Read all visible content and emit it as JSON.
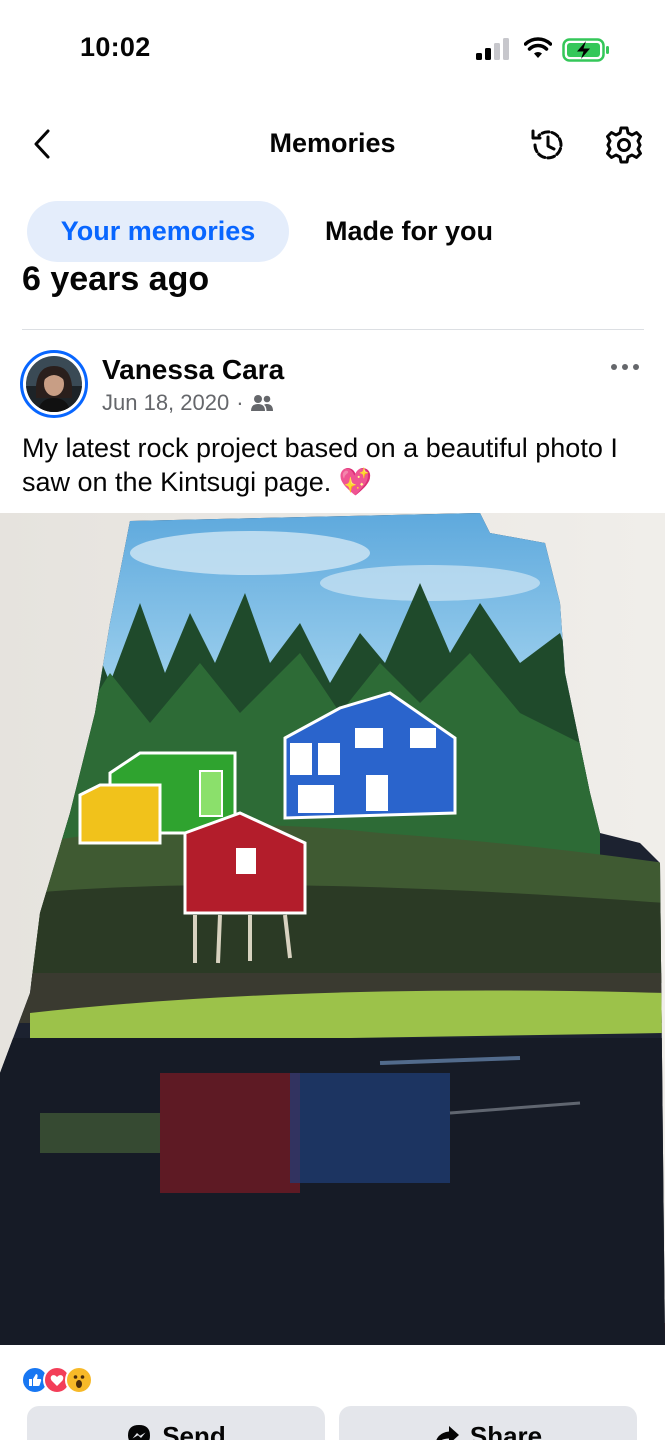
{
  "status_bar": {
    "time": "10:02",
    "icons": [
      "cellular-signal-icon",
      "wifi-icon",
      "battery-charging-icon"
    ]
  },
  "nav": {
    "title": "Memories",
    "icons": [
      "back-chevron-icon",
      "history-clock-icon",
      "settings-gear-icon"
    ]
  },
  "tabs": [
    {
      "label": "Your memories",
      "active": true
    },
    {
      "label": "Made for you",
      "active": false
    }
  ],
  "section_heading": "6 years ago",
  "post": {
    "author": "Vanessa Cara",
    "date": "Jun 18, 2020",
    "separator": "·",
    "audience_icon": "friends-audience-icon",
    "caption": "My latest rock project based on a beautiful photo I saw on the Kintsugi page. 💖",
    "reactions": [
      "like-icon",
      "love-icon",
      "wow-icon"
    ]
  },
  "actions": {
    "send_label": "Send",
    "share_label": "Share"
  },
  "colors": {
    "accent": "#0866ff",
    "active_tab_bg": "#e4edfb",
    "button_bg": "#e4e6eb",
    "secondary_text": "#65676b"
  }
}
